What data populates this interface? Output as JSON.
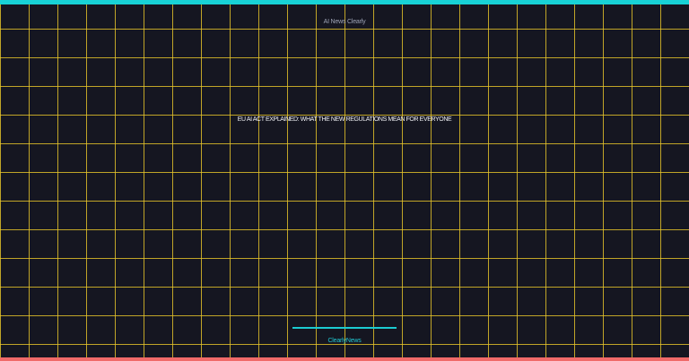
{
  "header": {
    "brand": "AI News Clearly"
  },
  "main": {
    "headline": "EU AI ACT EXPLAINED: WHAT THE NEW REGULATIONS MEAN FOR EVERYONE"
  },
  "footer": {
    "brand": "ClearlyNews"
  },
  "colors": {
    "background": "#151621",
    "grid": "#e6c42a",
    "accent_cyan": "#18d2d6",
    "accent_coral": "#f06a69",
    "headline_text": "#f0f1f4",
    "brand_text": "#9ea4b6"
  }
}
